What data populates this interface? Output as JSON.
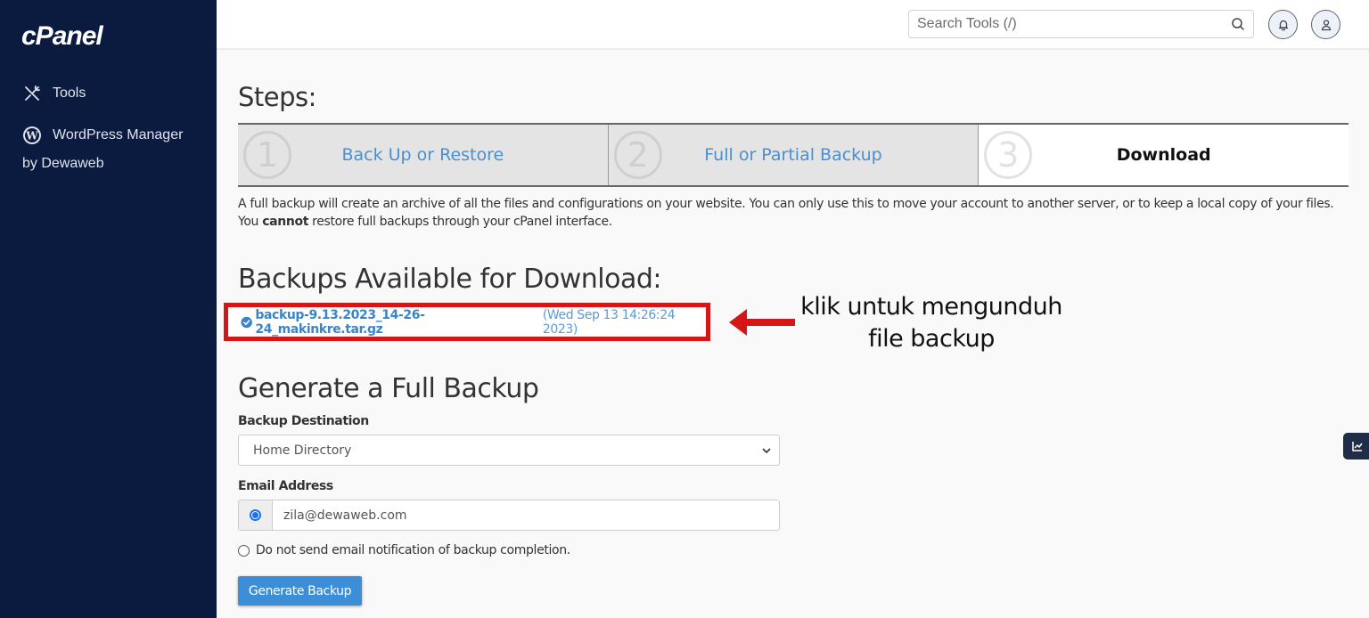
{
  "sidebar": {
    "logo": "cPanel",
    "items": [
      {
        "label": "Tools",
        "icon": "tools-icon"
      },
      {
        "label": "WordPress Manager",
        "sublabel": "by Dewaweb",
        "icon": "wordpress-icon"
      }
    ]
  },
  "topbar": {
    "search_placeholder": "Search Tools (/)",
    "icons": [
      "search-icon",
      "bell-icon",
      "user-icon"
    ]
  },
  "steps": {
    "title": "Steps:",
    "items": [
      {
        "number": "1",
        "label": "Back Up or Restore",
        "active": false
      },
      {
        "number": "2",
        "label": "Full or Partial Backup",
        "active": false
      },
      {
        "number": "3",
        "label": "Download",
        "active": true
      }
    ]
  },
  "description": {
    "text_before": "A full backup will create an archive of all the files and configurations on your website. You can only use this to move your account to another server, or to keep a local copy of your files. You ",
    "bold": "cannot",
    "text_after": " restore full backups through your cPanel interface."
  },
  "backups": {
    "heading": "Backups Available for Download:",
    "items": [
      {
        "filename": "backup-9.13.2023_14-26-24_makinkre.tar.gz",
        "date": "(Wed Sep 13 14:26:24 2023)"
      }
    ]
  },
  "annotation": {
    "line1": "klik untuk mengunduh",
    "line2": "file backup",
    "color": "#d41616"
  },
  "generate": {
    "heading": "Generate a Full Backup",
    "destination_label": "Backup Destination",
    "destination_value": "Home Directory",
    "email_label": "Email Address",
    "email_value": "zila@dewaweb.com",
    "email_selected": true,
    "no_email_label": "Do not send email notification of backup completion.",
    "button_label": "Generate Backup"
  },
  "colors": {
    "sidebar_bg": "#0b1a3f",
    "link": "#4a8fd1",
    "button": "#3c8fd6",
    "highlight": "#d41616"
  }
}
